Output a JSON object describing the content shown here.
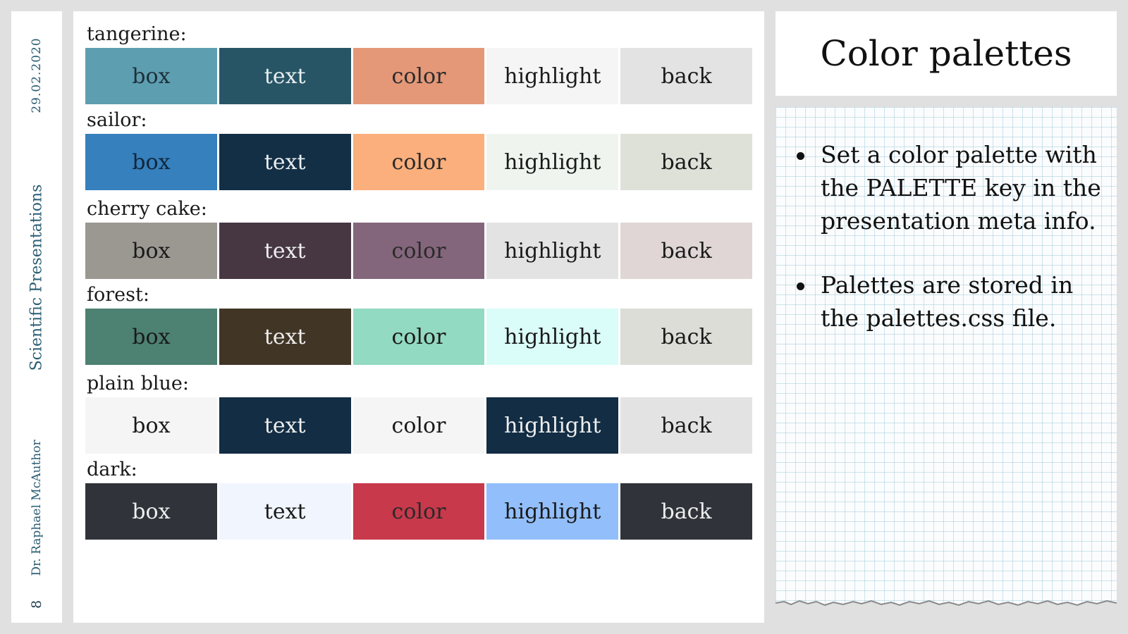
{
  "sidebar": {
    "date": "29.02.2020",
    "series": "Scientific Presentations",
    "author": "Dr. Raphael McAuthor",
    "page_number": "8"
  },
  "slide": {
    "title": "Color palettes"
  },
  "palettes": [
    {
      "label": "tangerine:",
      "swatches": [
        {
          "label": "box",
          "bg": "#5d9fb0",
          "fg": "#1f2f3a"
        },
        {
          "label": "text",
          "bg": "#275566",
          "fg": "#e8eef0"
        },
        {
          "label": "color",
          "bg": "#e49878",
          "fg": "#2b2b2b"
        },
        {
          "label": "highlight",
          "bg": "#f5f5f5",
          "fg": "#1a1a1a"
        },
        {
          "label": "back",
          "bg": "#e3e3e3",
          "fg": "#1a1a1a"
        }
      ]
    },
    {
      "label": "sailor:",
      "swatches": [
        {
          "label": "box",
          "bg": "#3580bd",
          "fg": "#13263a"
        },
        {
          "label": "text",
          "bg": "#132f45",
          "fg": "#e8eef0"
        },
        {
          "label": "color",
          "bg": "#fbaf7c",
          "fg": "#2b2b2b"
        },
        {
          "label": "highlight",
          "bg": "#eff4ef",
          "fg": "#1a1a1a"
        },
        {
          "label": "back",
          "bg": "#dee1d8",
          "fg": "#1a1a1a"
        }
      ]
    },
    {
      "label": "cherry cake:",
      "swatches": [
        {
          "label": "box",
          "bg": "#9b9892",
          "fg": "#1a1a1a"
        },
        {
          "label": "text",
          "bg": "#463743",
          "fg": "#eeeeee"
        },
        {
          "label": "color",
          "bg": "#84667c",
          "fg": "#2a2a2a"
        },
        {
          "label": "highlight",
          "bg": "#e4e3e3",
          "fg": "#1a1a1a"
        },
        {
          "label": "back",
          "bg": "#dfd6d5",
          "fg": "#1a1a1a"
        }
      ]
    },
    {
      "label": "forest:",
      "swatches": [
        {
          "label": "box",
          "bg": "#4d8171",
          "fg": "#1a1a1a"
        },
        {
          "label": "text",
          "bg": "#413526",
          "fg": "#eeeeee"
        },
        {
          "label": "color",
          "bg": "#92dac1",
          "fg": "#1a1a1a"
        },
        {
          "label": "highlight",
          "bg": "#dafdf9",
          "fg": "#1a1a1a"
        },
        {
          "label": "back",
          "bg": "#dbddd6",
          "fg": "#1a1a1a"
        }
      ]
    },
    {
      "label": "plain blue:",
      "swatches": [
        {
          "label": "box",
          "bg": "#f5f5f5",
          "fg": "#1a1a1a"
        },
        {
          "label": "text",
          "bg": "#122d44",
          "fg": "#eeeeee"
        },
        {
          "label": "color",
          "bg": "#f5f5f5",
          "fg": "#1a1a1a"
        },
        {
          "label": "highlight",
          "bg": "#122d44",
          "fg": "#eeeeee"
        },
        {
          "label": "back",
          "bg": "#e3e3e3",
          "fg": "#1a1a1a"
        }
      ]
    },
    {
      "label": "dark:",
      "swatches": [
        {
          "label": "box",
          "bg": "#30343a",
          "fg": "#eeeeee"
        },
        {
          "label": "text",
          "bg": "#f1f5fe",
          "fg": "#1a1a1a"
        },
        {
          "label": "color",
          "bg": "#c8394b",
          "fg": "#2a2a2a"
        },
        {
          "label": "highlight",
          "bg": "#92bffb",
          "fg": "#1a1a1a"
        },
        {
          "label": "back",
          "bg": "#30343a",
          "fg": "#eeeeee"
        }
      ]
    }
  ],
  "notes": {
    "bullets": [
      "Set a color palette with the PALETTE key in the presentation meta info.",
      "Palettes are stored in the palettes.css file."
    ]
  }
}
